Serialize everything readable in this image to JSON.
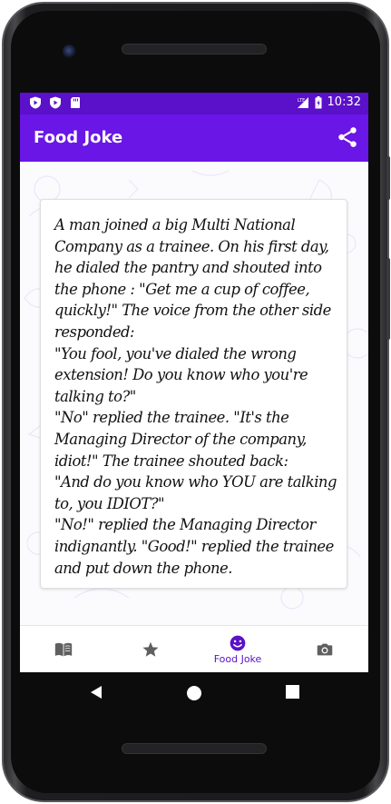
{
  "status_bar": {
    "time": "10:32",
    "left_icons": [
      "play-protect-icon",
      "play-icon",
      "sd-card-icon"
    ],
    "right_icons": [
      "lte-signal-icon",
      "battery-icon"
    ]
  },
  "app_bar": {
    "title": "Food Joke",
    "action_icon": "share-icon"
  },
  "joke": {
    "text": "A man joined a big Multi National Company as a trainee. On his first day, he dialed the pantry and shouted into the phone : \"Get me a cup of coffee, quickly!\" The voice from the other side responded:\n\"You fool, you've dialed the wrong extension! Do you know who you're talking to?\"\n\"No\" replied the trainee. \"It's the Managing Director of the company, idiot!\" The trainee shouted back:\n\"And do you know who YOU are talking to, you IDIOT?\"\n\"No!\" replied the Managing Director indignantly. \"Good!\" replied the trainee and put down the phone."
  },
  "bottom_nav": {
    "items": [
      {
        "icon": "book-icon",
        "label": "",
        "selected": false
      },
      {
        "icon": "star-icon",
        "label": "",
        "selected": false
      },
      {
        "icon": "smiley-icon",
        "label": "Food Joke",
        "selected": true
      },
      {
        "icon": "camera-icon",
        "label": "",
        "selected": false
      }
    ]
  },
  "system_nav": [
    "back-icon",
    "home-icon",
    "recents-icon"
  ],
  "colors": {
    "status_bar": "#5b10c9",
    "app_bar": "#6a16e6",
    "accent": "#5b10c9",
    "nav_inactive": "#5f5f5f"
  }
}
